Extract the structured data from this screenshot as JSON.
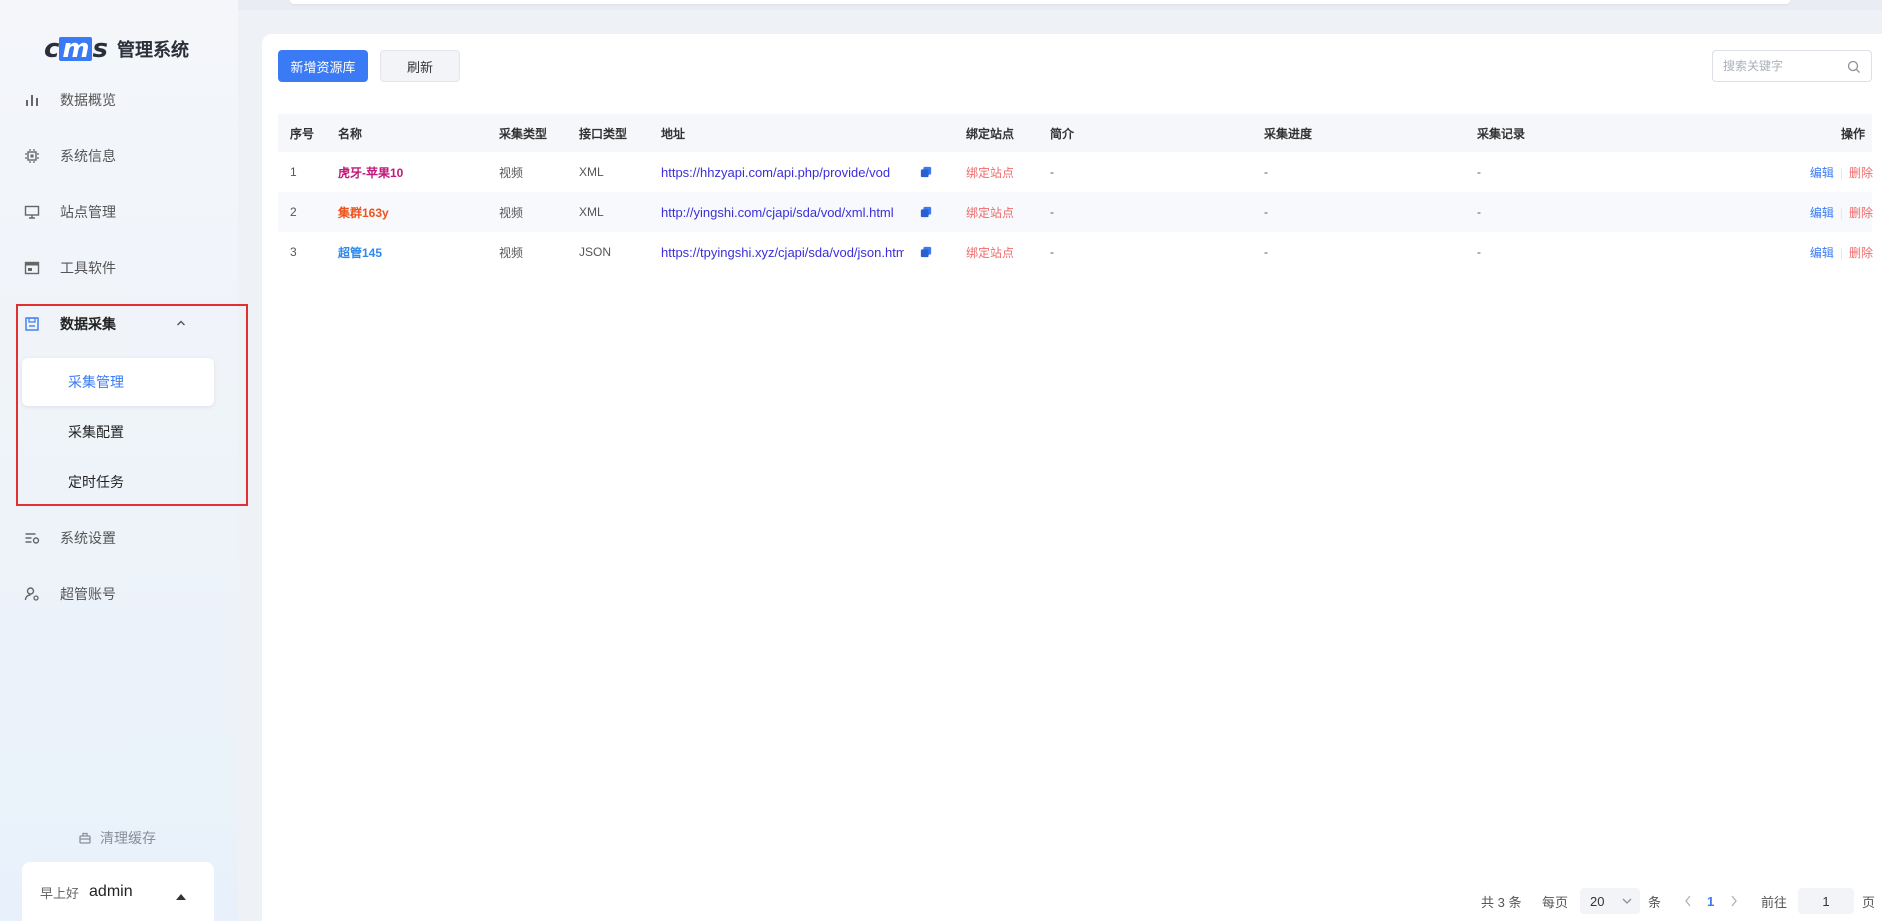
{
  "brand": {
    "logo_text": "cms",
    "title": "管理系统"
  },
  "sidebar": {
    "items": [
      {
        "label": "数据概览",
        "icon": "bar-chart-icon"
      },
      {
        "label": "系统信息",
        "icon": "chip-icon"
      },
      {
        "label": "站点管理",
        "icon": "monitor-icon"
      },
      {
        "label": "工具软件",
        "icon": "window-icon"
      },
      {
        "label": "数据采集",
        "icon": "save-icon"
      },
      {
        "label": "系统设置",
        "icon": "settings-sliders-icon"
      },
      {
        "label": "超管账号",
        "icon": "user-gear-icon"
      }
    ],
    "sub_items": [
      {
        "label": "采集管理"
      },
      {
        "label": "采集配置"
      },
      {
        "label": "定时任务"
      }
    ],
    "clear_cache": "清理缓存",
    "user": {
      "greeting": "早上好",
      "name": "admin"
    }
  },
  "toolbar": {
    "add_label": "新增资源库",
    "refresh_label": "刷新",
    "search_placeholder": "搜索关键字"
  },
  "table": {
    "columns": [
      "序号",
      "名称",
      "采集类型",
      "接口类型",
      "地址",
      "绑定站点",
      "简介",
      "采集进度",
      "采集记录",
      "操作"
    ],
    "rows": [
      {
        "idx": "1",
        "name": "虎牙-苹果10",
        "name_color": "#c2187a",
        "type": "视频",
        "api": "XML",
        "url": "https://hhzyapi.com/api.php/provide/vod",
        "bind": "绑定站点",
        "intro": "-",
        "progress": "-",
        "record": "-",
        "edit": "编辑",
        "delete": "删除"
      },
      {
        "idx": "2",
        "name": "集群163y",
        "name_color": "#f0521a",
        "type": "视频",
        "api": "XML",
        "url": "http://yingshi.com/cjapi/sda/vod/xml.html",
        "bind": "绑定站点",
        "intro": "-",
        "progress": "-",
        "record": "-",
        "edit": "编辑",
        "delete": "删除"
      },
      {
        "idx": "3",
        "name": "超管145",
        "name_color": "#2f8af0",
        "type": "视频",
        "api": "JSON",
        "url": "https://tpyingshi.xyz/cjapi/sda/vod/json.html",
        "bind": "绑定站点",
        "intro": "-",
        "progress": "-",
        "record": "-",
        "edit": "编辑",
        "delete": "删除"
      }
    ]
  },
  "pagination": {
    "total": "共 3 条",
    "per_page_label": "每页",
    "page_size": "20",
    "unit": "条",
    "current_page": "1",
    "goto_label": "前往",
    "goto_value": "1",
    "page_unit": "页"
  }
}
